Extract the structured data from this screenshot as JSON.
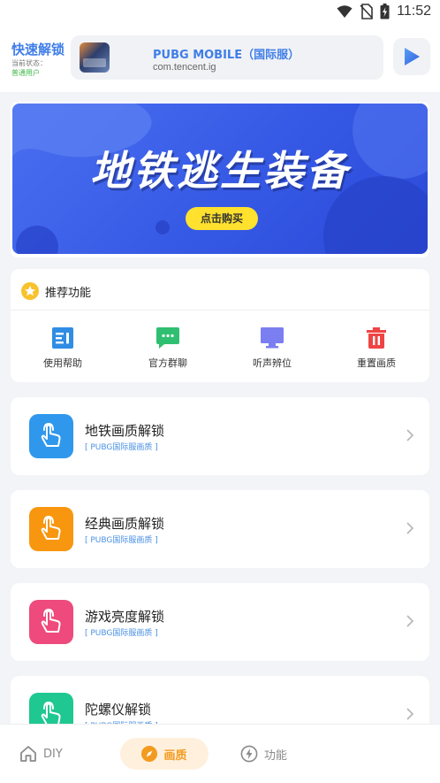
{
  "status_bar": {
    "time": "11:52",
    "icons": [
      "wifi-icon",
      "no-sim-icon",
      "battery-charging-icon"
    ]
  },
  "header": {
    "app_name": "快速解锁",
    "status_label": "当前状态：",
    "status_value": "普通用户",
    "game": {
      "title": "PUBG MOBILE（国际服）",
      "package": "com.tencent.ig"
    },
    "play_icon": "play-triangle-icon"
  },
  "banner": {
    "title": "地铁逃生装备",
    "button": "点击购买"
  },
  "recommend": {
    "title": "推荐功能",
    "items": [
      {
        "label": "使用帮助",
        "icon": "help-doc-icon",
        "color": "#2f8de4"
      },
      {
        "label": "官方群聊",
        "icon": "chat-icon",
        "color": "#2fbf71"
      },
      {
        "label": "听声辨位",
        "icon": "monitor-icon",
        "color": "#7b7ef0"
      },
      {
        "label": "重置画质",
        "icon": "trash-icon",
        "color": "#ef4444"
      }
    ]
  },
  "features": [
    {
      "title": "地铁画质解锁",
      "subtitle": "[ PUBG国际服画质 ]",
      "color": "#2f98ec",
      "icon": "tap-hand-icon"
    },
    {
      "title": "经典画质解锁",
      "subtitle": "[ PUBG国际服画质 ]",
      "color": "#f8960f",
      "icon": "tap-hand-icon"
    },
    {
      "title": "游戏亮度解锁",
      "subtitle": "[ PUBG国际服画质 ]",
      "color": "#ee4a7d",
      "icon": "tap-hand-icon"
    },
    {
      "title": "陀螺仪解锁",
      "subtitle": "[ PUBG国际服画质 ]",
      "color": "#1fc791",
      "icon": "tap-hand-icon"
    }
  ],
  "bottom_nav": [
    {
      "label": "DIY",
      "icon": "home-icon",
      "active": false
    },
    {
      "label": "画质",
      "icon": "compass-icon",
      "active": true
    },
    {
      "label": "功能",
      "icon": "lightning-icon",
      "active": false
    }
  ],
  "colors": {
    "accent": "#3f7ee8",
    "nav_active": "#f39b1f",
    "banner_blue": "#3457e4",
    "banner_button": "#ffe12e"
  }
}
